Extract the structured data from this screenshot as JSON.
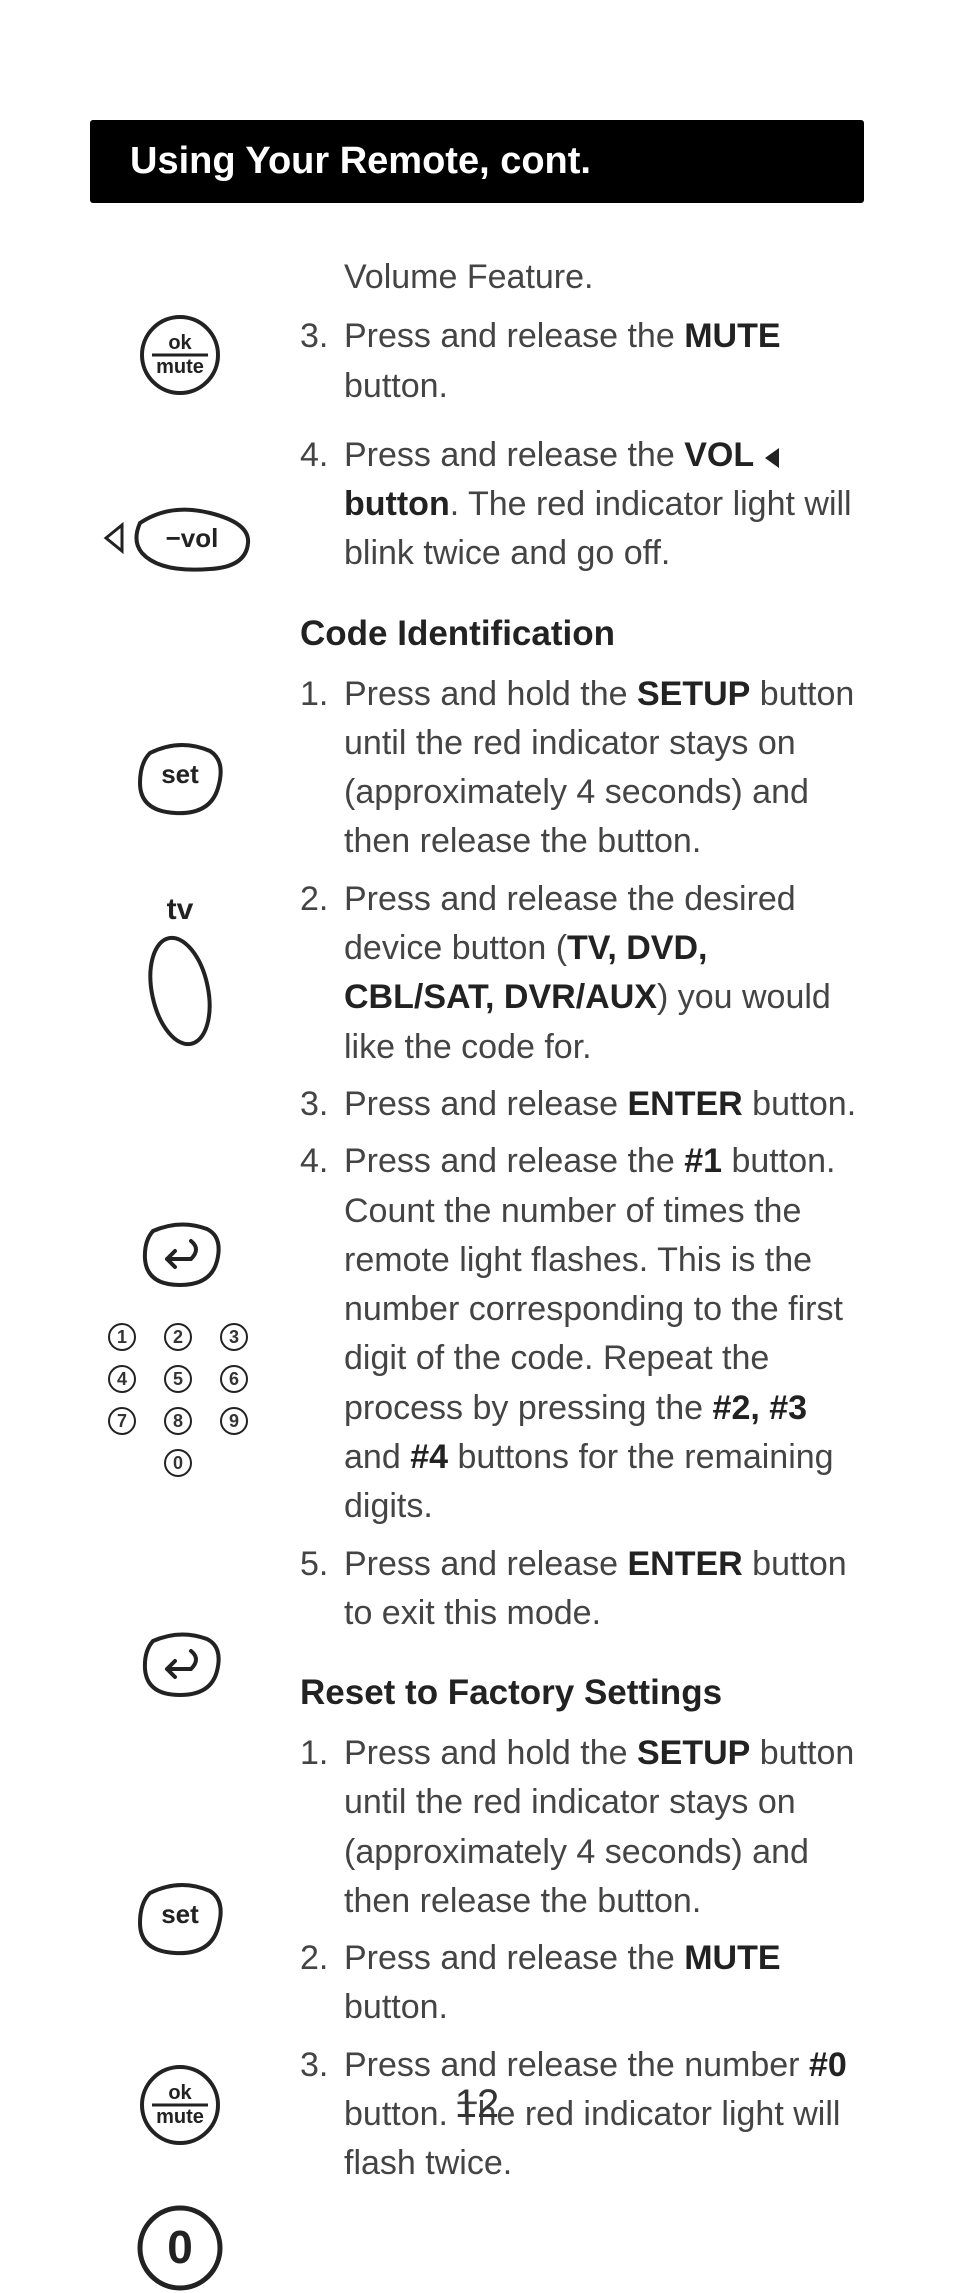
{
  "header": "Using Your Remote, cont.",
  "page_number": "12",
  "intro": "Volume Feature.",
  "vol_steps": [
    {
      "n": "3.",
      "pre": "Press and release the ",
      "b1": "MUTE",
      "post": " button."
    },
    {
      "n": "4.",
      "pre": "Press and release the ",
      "b1": "VOL ◂ button",
      "post": ". The red indicator light will blink twice and go off."
    }
  ],
  "code_title": "Code Identification",
  "code_steps": [
    {
      "n": "1.",
      "pre": "Press and hold the ",
      "b1": "SETUP",
      "post": " button until the red indicator stays on (approximately 4 seconds) and then release the button."
    },
    {
      "n": "2.",
      "pre": "Press and release the desired device button (",
      "b1": "TV, DVD, CBL/SAT, DVR/AUX",
      "post": ") you would like the code for."
    },
    {
      "n": "3.",
      "pre": "Press and release ",
      "b1": "ENTER",
      "post": " button."
    },
    {
      "n": "4.",
      "pre": "Press and release the ",
      "b1": "#1",
      "mid": " button. Count the number of times the remote light flashes. This is the number corresponding to the first digit of the code. Repeat the process by pressing the ",
      "b2": "#2, #3",
      "mid2": " and ",
      "b3": "#4",
      "post": " buttons for the remaining digits."
    },
    {
      "n": "5.",
      "pre": "Press and release ",
      "b1": "ENTER",
      "post": " button to exit this mode."
    }
  ],
  "reset_title": "Reset to Factory Settings",
  "reset_steps": [
    {
      "n": "1.",
      "pre": "Press and hold the ",
      "b1": "SETUP",
      "post": " button until the red indicator stays on (approximately 4 seconds) and then release the button."
    },
    {
      "n": "2.",
      "pre": "Press and release the ",
      "b1": "MUTE",
      "post": " button."
    },
    {
      "n": "3.",
      "pre": "Press and release the number ",
      "b1": "#0",
      "post": " button. The red indicator light will flash twice."
    }
  ],
  "icons": {
    "okmute_top": "ok",
    "okmute_bot": "mute",
    "vol_label": "−vol",
    "set_label": "set",
    "tv_label": "tv",
    "zero_label": "0"
  }
}
